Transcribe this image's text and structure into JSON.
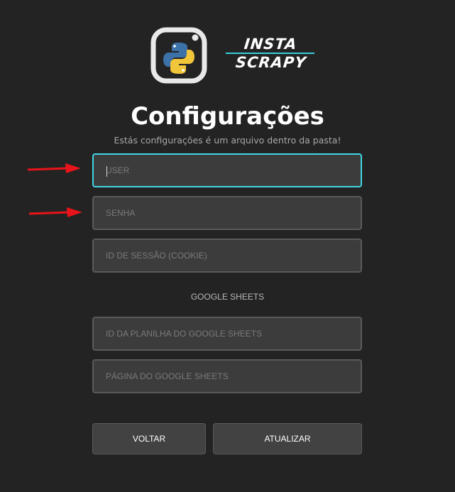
{
  "brand": {
    "line1": "INSTA",
    "line2": "SCRAPY",
    "accent_color": "#39d0d8",
    "logo_icon": "python-icon"
  },
  "page": {
    "title": "Configurações",
    "subtitle": "Estás configurações é um arquivo dentro da pasta!"
  },
  "fields": {
    "user_placeholder": "USER",
    "password_placeholder": "SENHA",
    "session_placeholder": "ID DE SESSÃO (COOKIE)",
    "sheet_id_placeholder": "ID DA PLANILHA DO GOOGLE SHEETS",
    "sheet_page_placeholder": "PÁGINA DO GOOGLE SHEETS"
  },
  "section": {
    "google_sheets_label": "GOOGLE SHEETS"
  },
  "buttons": {
    "back_label": "VOLTAR",
    "update_label": "ATUALIZAR"
  },
  "annotations": {
    "arrow_color": "#e8141a",
    "focus_color": "#3fd8e2"
  }
}
